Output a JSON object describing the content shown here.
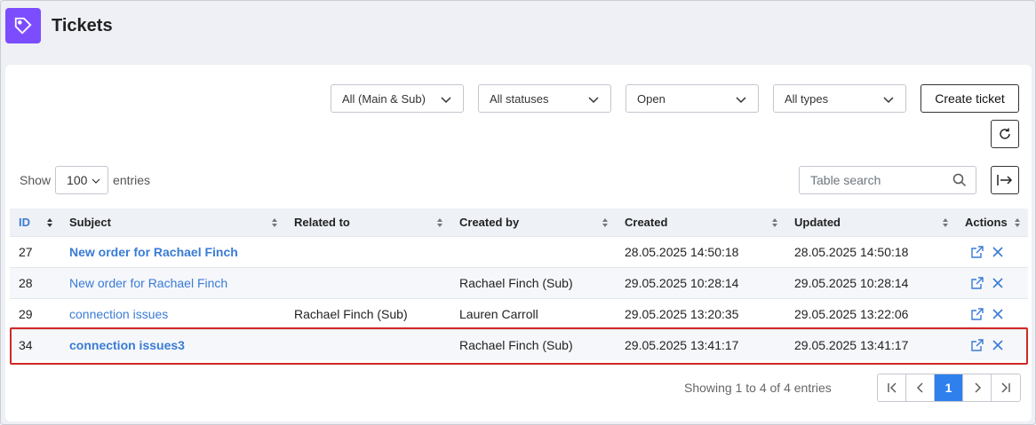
{
  "header": {
    "title": "Tickets",
    "logo_icon": "ticket-icon"
  },
  "filters": [
    {
      "name": "filter-scope",
      "value": "All (Main & Sub)"
    },
    {
      "name": "filter-status",
      "value": "All statuses"
    },
    {
      "name": "filter-state",
      "value": "Open"
    },
    {
      "name": "filter-type",
      "value": "All types"
    }
  ],
  "toolbar": {
    "create_label": "Create ticket"
  },
  "length": {
    "show": "Show",
    "value": "100",
    "entries": "entries"
  },
  "search": {
    "placeholder": "Table search"
  },
  "table": {
    "columns": [
      "ID",
      "Subject",
      "Related to",
      "Created by",
      "Created",
      "Updated",
      "Actions"
    ],
    "rows": [
      {
        "id": "27",
        "subject": "New order for Rachael Finch",
        "bold": true,
        "related": "",
        "created_by": "",
        "created": "28.05.2025 14:50:18",
        "updated": "28.05.2025 14:50:18"
      },
      {
        "id": "28",
        "subject": "New order for Rachael Finch",
        "bold": false,
        "related": "",
        "created_by": "Rachael Finch (Sub)",
        "created": "29.05.2025 10:28:14",
        "updated": "29.05.2025 10:28:14"
      },
      {
        "id": "29",
        "subject": "connection issues",
        "bold": false,
        "related": "Rachael Finch (Sub)",
        "created_by": "Lauren Carroll",
        "created": "29.05.2025 13:20:35",
        "updated": "29.05.2025 13:22:06"
      },
      {
        "id": "34",
        "subject": "connection issues3",
        "bold": true,
        "related": "",
        "created_by": "Rachael Finch (Sub)",
        "created": "29.05.2025 13:41:17",
        "updated": "29.05.2025 13:41:17"
      }
    ]
  },
  "footer": {
    "info": "Showing 1 to 4 of 4 entries",
    "page": "1"
  },
  "colors": {
    "accent": "#7c4dff",
    "link": "#3a7bd5",
    "highlight": "#d02828"
  }
}
